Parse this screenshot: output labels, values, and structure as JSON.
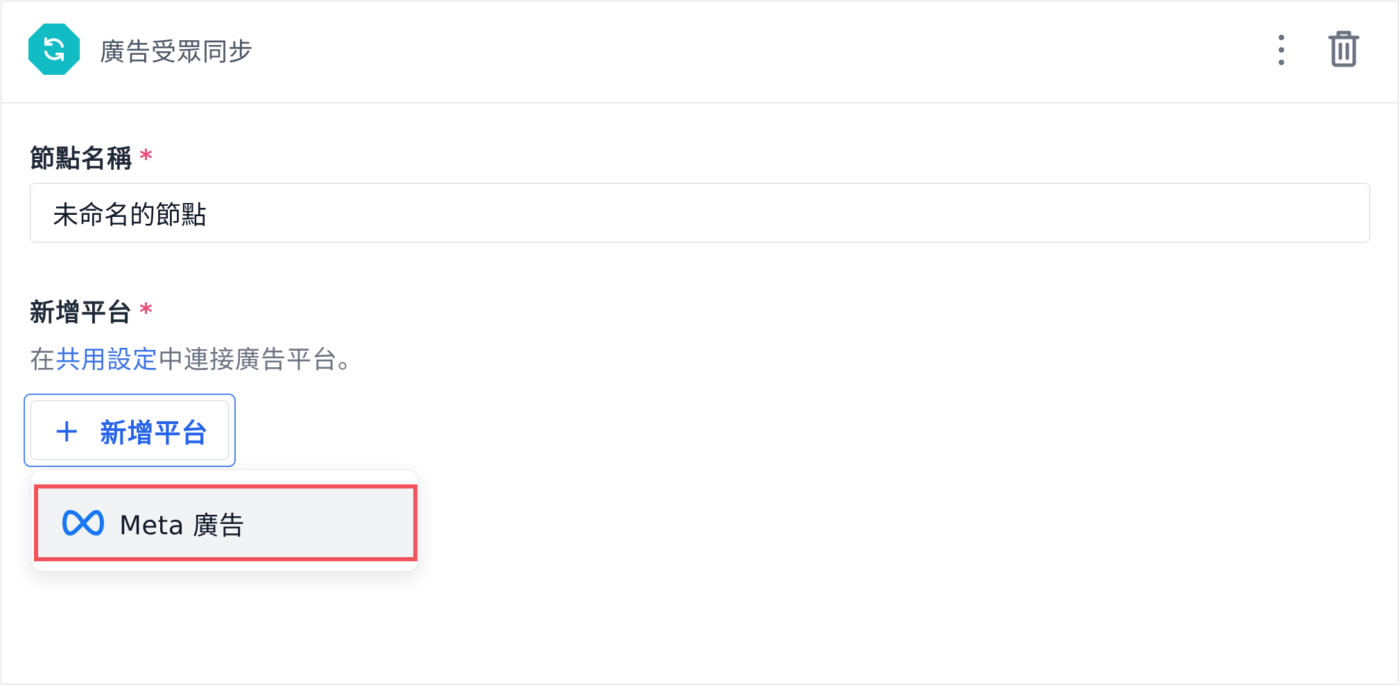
{
  "header": {
    "icon": "sync-icon",
    "title": "廣告受眾同步",
    "more_icon": "more-vertical-icon",
    "delete_icon": "trash-icon"
  },
  "node_name": {
    "label": "節點名稱",
    "required_mark": "*",
    "value": "未命名的節點"
  },
  "platform": {
    "label": "新增平台",
    "required_mark": "*",
    "helper_prefix": "在",
    "helper_link": "共用設定",
    "helper_suffix": "中連接廣告平台。",
    "add_button_icon": "+",
    "add_button_label": "新增平台"
  },
  "dropdown": {
    "items": [
      {
        "icon": "meta-logo-icon",
        "label": "Meta 廣告"
      }
    ]
  },
  "colors": {
    "accent": "#2563eb",
    "node_icon": "#12bcc5",
    "required": "#ec4d7a",
    "highlight": "#f2545b"
  }
}
